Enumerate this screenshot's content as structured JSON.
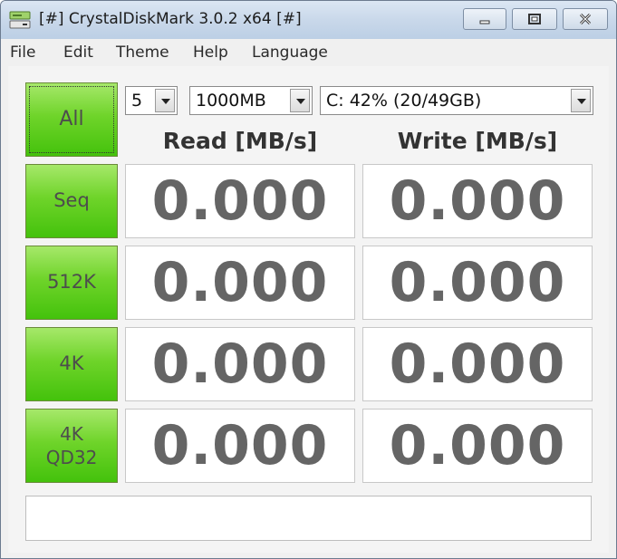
{
  "window": {
    "title": "[#] CrystalDiskMark 3.0.2 x64 [#]",
    "accent": "#c9d8ea"
  },
  "menu": {
    "items": [
      "File",
      "Edit",
      "Theme",
      "Help",
      "Language"
    ]
  },
  "controls": {
    "all_label": "All",
    "runs": "5",
    "size": "1000MB",
    "drive": "C: 42% (20/49GB)"
  },
  "headers": {
    "read": "Read [MB/s]",
    "write": "Write [MB/s]"
  },
  "tests": [
    {
      "label_line1": "Seq",
      "label_line2": "",
      "read": "0.000",
      "write": "0.000"
    },
    {
      "label_line1": "512K",
      "label_line2": "",
      "read": "0.000",
      "write": "0.000"
    },
    {
      "label_line1": "4K",
      "label_line2": "",
      "read": "0.000",
      "write": "0.000"
    },
    {
      "label_line1": "4K",
      "label_line2": "QD32",
      "read": "0.000",
      "write": "0.000"
    }
  ],
  "status": {
    "text": ""
  },
  "colors": {
    "button_green": "#5ccc1e",
    "value_gray": "#656565"
  },
  "icons": {
    "app": "disk-icon",
    "minimize": "minimize-icon",
    "maximize": "maximize-icon",
    "close": "close-icon",
    "dropdown": "chevron-down-icon"
  }
}
